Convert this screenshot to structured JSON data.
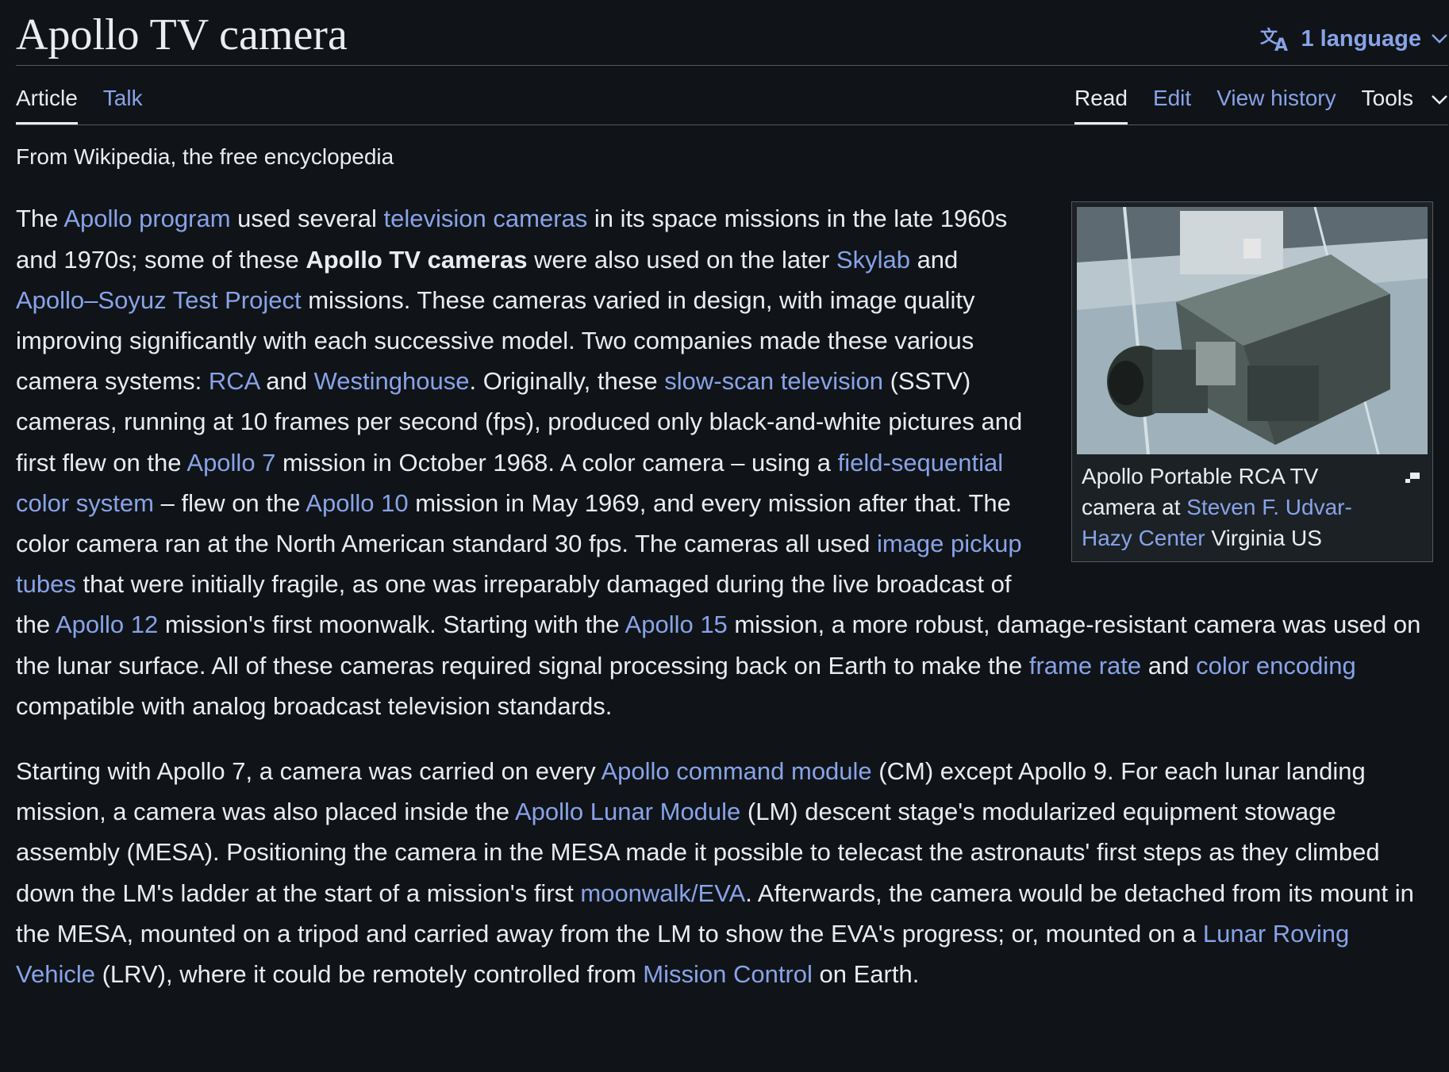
{
  "header": {
    "title": "Apollo TV camera",
    "language_label": "1 language"
  },
  "tabs": {
    "article": "Article",
    "talk": "Talk",
    "read": "Read",
    "edit": "Edit",
    "history": "View history",
    "tools": "Tools"
  },
  "tagline": "From Wikipedia, the free encyclopedia",
  "figure": {
    "caption_1": "Apollo Portable RCA TV camera at ",
    "caption_link": "Steven F. Udvar-Hazy Center",
    "caption_2": " Virginia US"
  },
  "p1": {
    "t1": "The ",
    "l1": "Apollo program",
    "t2": " used several ",
    "l2": "television cameras",
    "t3": " in its space missions in the late 1960s and 1970s; some of these ",
    "b1": "Apollo TV cameras",
    "t4": " were also used on the later ",
    "l3": "Skylab",
    "t5": " and ",
    "l4": "Apollo–Soyuz Test Project",
    "t6": " missions. These cameras varied in design, with image quality improving significantly with each successive model. Two companies made these various camera systems: ",
    "l5": "RCA",
    "t7": " and ",
    "l6": "Westinghouse",
    "t8": ". Originally, these ",
    "l7": "slow-scan television",
    "t9": " (SSTV) cameras, running at 10 frames per second (fps), produced only black-and-white pictures and first flew on the ",
    "l8": "Apollo 7",
    "t10": " mission in October 1968. A color camera – using a ",
    "l9": "field-sequential color system",
    "t11": " – flew on the ",
    "l10": "Apollo 10",
    "t12": " mission in May 1969, and every mission after that. The color camera ran at the North American standard 30 fps. The cameras all used ",
    "l11": "image pickup tubes",
    "t13": " that were initially fragile, as one was irreparably damaged during the live broadcast of the ",
    "l12": "Apollo 12",
    "t14": " mission's first moonwalk. Starting with the ",
    "l13": "Apollo 15",
    "t15": " mission, a more robust, damage-resistant camera was used on the lunar surface. All of these cameras required signal processing back on Earth to make the ",
    "l14": "frame rate",
    "t16": " and ",
    "l15": "color encoding",
    "t17": " compatible with analog broadcast television standards."
  },
  "p2": {
    "t1": "Starting with Apollo 7, a camera was carried on every ",
    "l1": "Apollo command module",
    "t2": " (CM) except Apollo 9. For each lunar landing mission, a camera was also placed inside the ",
    "l2": "Apollo Lunar Module",
    "t3": " (LM) descent stage's modularized equipment stowage assembly (MESA). Positioning the camera in the MESA made it possible to telecast the astronauts' first steps as they climbed down the LM's ladder at the start of a mission's first ",
    "l3": "moonwalk/EVA",
    "t4": ". Afterwards, the camera would be detached from its mount in the MESA, mounted on a tripod and carried away from the LM to show the EVA's progress; or, mounted on a ",
    "l4": "Lunar Roving Vehicle",
    "t5": " (LRV), where it could be remotely controlled from ",
    "l5": "Mission Control",
    "t6": " on Earth."
  }
}
